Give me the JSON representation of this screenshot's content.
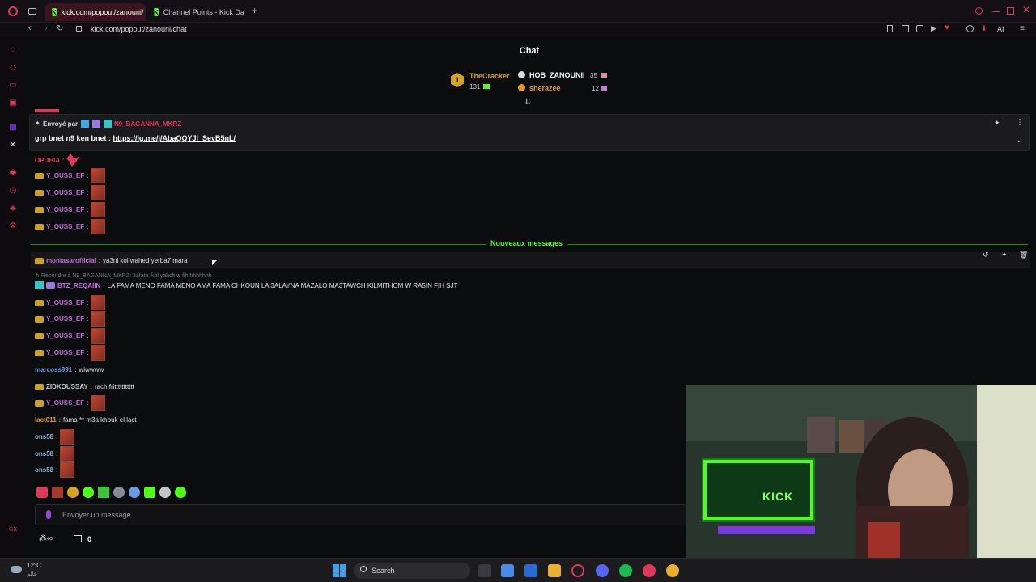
{
  "tabs": [
    {
      "title": "kick.com/popout/zanouni/"
    },
    {
      "title": "Channel Points - Kick Das"
    }
  ],
  "address": "kick.com/popout/zanouni/chat",
  "address_ai": "AI",
  "chat": {
    "title": "Chat",
    "leaders": [
      {
        "rank": "1",
        "name": "TheCracker",
        "points": "131",
        "color": "#d8a323"
      },
      {
        "name": "HOB_ZANOUNII",
        "points": "35",
        "color": "#ffffff"
      },
      {
        "name": "sherazee",
        "points": "12",
        "color": "#e8982a"
      }
    ],
    "pinned": {
      "sent_by_label": "Envoyé par",
      "sender": "N9_BAGANNA_MKRZ",
      "text": "grp bnet n9 ken bnet : ",
      "link": "https://ig.me/j/AbaQQYJl_SevB5nL/"
    },
    "messages_before": [
      {
        "user": "OPDHIA",
        "color": "#e0385b",
        "text": "",
        "emote": true
      },
      {
        "user": "Y_OUSS_EF",
        "color": "#c96ae0",
        "text": "",
        "emote": true
      },
      {
        "user": "Y_OUSS_EF",
        "color": "#c96ae0",
        "text": "",
        "emote": true
      },
      {
        "user": "Y_OUSS_EF",
        "color": "#c96ae0",
        "text": "",
        "emote": true
      },
      {
        "user": "Y_OUSS_EF",
        "color": "#c96ae0",
        "text": "",
        "emote": true
      }
    ],
    "new_messages_label": "Nouveaux messages",
    "messages_after": [
      {
        "user": "montasarofficial",
        "color": "#c96ae0",
        "text": "ya3ni kol wahed yerba7 mara"
      },
      {
        "reply": "Répondre à N9_BAGANNA_MKRZ: 3afata lkol yahchiw fih hhhhhhh",
        "user": "BTZ_REQAIIN",
        "color": "#c96ae0",
        "text": "LA FAMA MENO FAMA MENO AMA FAMA CHKOUN LA 3ALAYNA MAZALO MA3TAWCH KILMITHOM W RA5IN FIH SJT"
      },
      {
        "user": "Y_OUSS_EF",
        "color": "#c96ae0",
        "text": "",
        "emote": true
      },
      {
        "user": "Y_OUSS_EF",
        "color": "#c96ae0",
        "text": "",
        "emote": true
      },
      {
        "user": "Y_OUSS_EF",
        "color": "#c96ae0",
        "text": "",
        "emote": true
      },
      {
        "user": "Y_OUSS_EF",
        "color": "#c96ae0",
        "text": "",
        "emote": true
      },
      {
        "user": "marcoss991",
        "color": "#6c9ee6",
        "text": "wiwwww"
      },
      {
        "user": "ZIDKOUSSAY",
        "color": "#cfcfcf",
        "text": "rach frittttttttttt"
      },
      {
        "user": "Y_OUSS_EF",
        "color": "#c96ae0",
        "text": "",
        "emote": true
      },
      {
        "user": "lact011",
        "color": "#e8982a",
        "text": "fama ** m3a khouk el lact"
      },
      {
        "user": "ons58",
        "color": "#9ab6e0",
        "text": "",
        "emote": true
      },
      {
        "user": "ons58",
        "color": "#9ab6e0",
        "text": "",
        "emote": true
      },
      {
        "user": "ons58",
        "color": "#9ab6e0",
        "text": "",
        "emote": true
      }
    ],
    "input_placeholder": "Envoyer un message",
    "points_count": "0"
  },
  "taskbar": {
    "weather_temp": "12°C",
    "weather_desc": "عالم",
    "search_label": "Search"
  },
  "webcam": {
    "sign_text": "KICK"
  }
}
